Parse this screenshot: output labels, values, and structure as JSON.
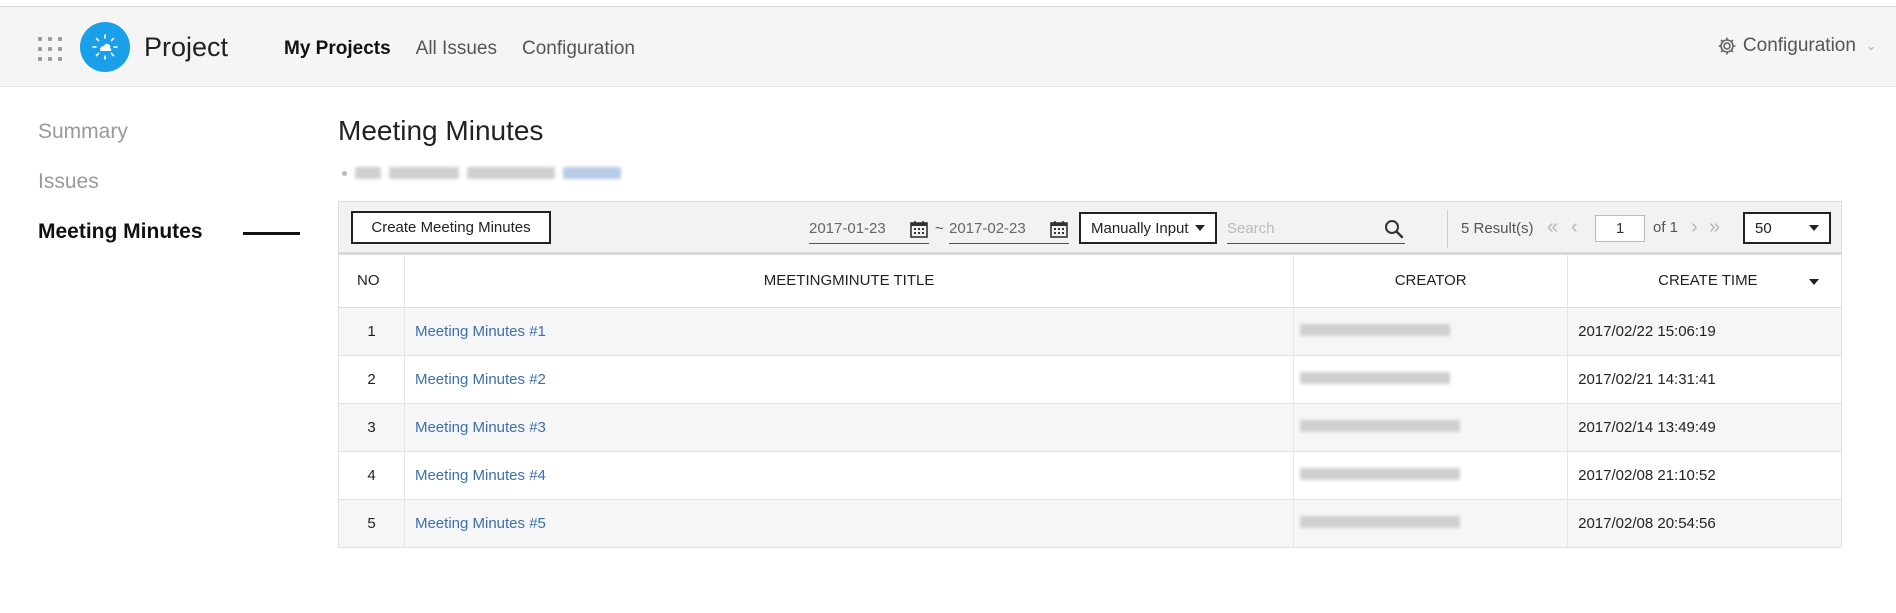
{
  "header": {
    "app_title": "Project",
    "nav": [
      {
        "label": "My Projects",
        "active": true
      },
      {
        "label": "All Issues",
        "active": false
      },
      {
        "label": "Configuration",
        "active": false
      }
    ],
    "config_menu_label": "Configuration",
    "icons": {
      "apps": "apps-grid-icon",
      "logo": "project-logo-icon",
      "settings": "gear-icon"
    }
  },
  "sidebar": {
    "items": [
      {
        "label": "Summary",
        "active": false
      },
      {
        "label": "Issues",
        "active": false
      },
      {
        "label": "Meeting Minutes",
        "active": true
      }
    ]
  },
  "main": {
    "title": "Meeting Minutes",
    "toolbar": {
      "create_label": "Create Meeting Minutes",
      "date_from": "2017-01-23",
      "date_to": "2017-02-23",
      "date_separator": "~",
      "input_mode": "Manually Input",
      "search_placeholder": "Search",
      "results_text": "5 Result(s)",
      "current_page": "1",
      "of_text": "of 1",
      "page_size": "50"
    },
    "table": {
      "headers": [
        "NO",
        "MEETINGMINUTE TITLE",
        "CREATOR",
        "CREATE TIME"
      ],
      "rows": [
        {
          "no": "1",
          "title": "Meeting Minutes #1",
          "time": "2017/02/22 15:06:19"
        },
        {
          "no": "2",
          "title": "Meeting Minutes #2",
          "time": "2017/02/21 14:31:41"
        },
        {
          "no": "3",
          "title": "Meeting Minutes #3",
          "time": "2017/02/14 13:49:49"
        },
        {
          "no": "4",
          "title": "Meeting Minutes #4",
          "time": "2017/02/08 21:10:52"
        },
        {
          "no": "5",
          "title": "Meeting Minutes #5",
          "time": "2017/02/08 20:54:56"
        }
      ]
    }
  },
  "colors": {
    "accent": "#1aa0e8",
    "link": "#3c6fb0"
  }
}
